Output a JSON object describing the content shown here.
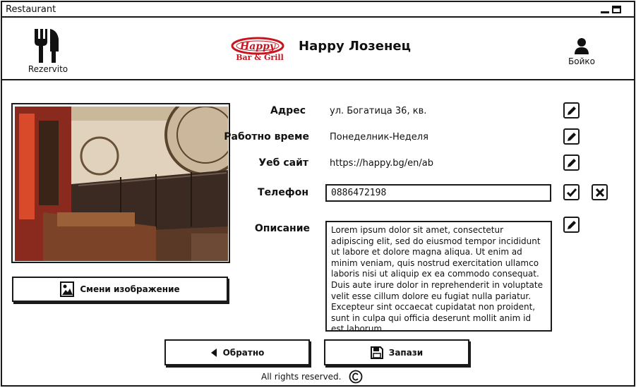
{
  "window": {
    "title": "Restaurant"
  },
  "header": {
    "app_name": "Rezervito",
    "brand_logo_text": "Happy",
    "brand_logo_tagline": "Bar & Grill",
    "restaurant_name": "Happy Лозенец",
    "user_name": "Бойко"
  },
  "image_panel": {
    "change_button_label": "Смени изображение"
  },
  "details": {
    "address_label": "Адрес",
    "address_value": "ул. Богатица 36, кв.",
    "hours_label": "Работно време",
    "hours_value": "Понеделник-Неделя",
    "website_label": "Уеб сайт",
    "website_value": "https://happy.bg/en/ab",
    "phone_label": "Телефон",
    "phone_value": "0886472198",
    "description_label": "Описание",
    "description_value": "Lorem ipsum dolor sit amet, consectetur adipiscing elit, sed do eiusmod tempor incididunt ut labore et dolore magna aliqua. Ut enim ad minim veniam, quis nostrud exercitation ullamco laboris nisi ut aliquip ex  ea commodo consequat. Duis aute irure dolor in reprehenderit in voluptate velit esse cillum dolore eu fugiat nulla pariatur. Excepteur sint occaecat cupidatat non proident, sunt in culpa qui officia deserunt mollit anim id est laborum."
  },
  "actions": {
    "back_label": "Обратно",
    "save_label": "Запази"
  },
  "footer": {
    "text": "All rights reserved."
  },
  "icons": {
    "app_logo": "fork-knife-icon",
    "user": "user-icon",
    "edit": "pencil-icon",
    "confirm": "check-icon",
    "cancel": "close-icon",
    "image": "image-icon",
    "back": "caret-left-icon",
    "save": "floppy-disk-icon",
    "copyright": "copyright-icon"
  },
  "colors": {
    "border": "#1a1a1a",
    "brand_red": "#c8141e",
    "background": "#ffffff"
  }
}
